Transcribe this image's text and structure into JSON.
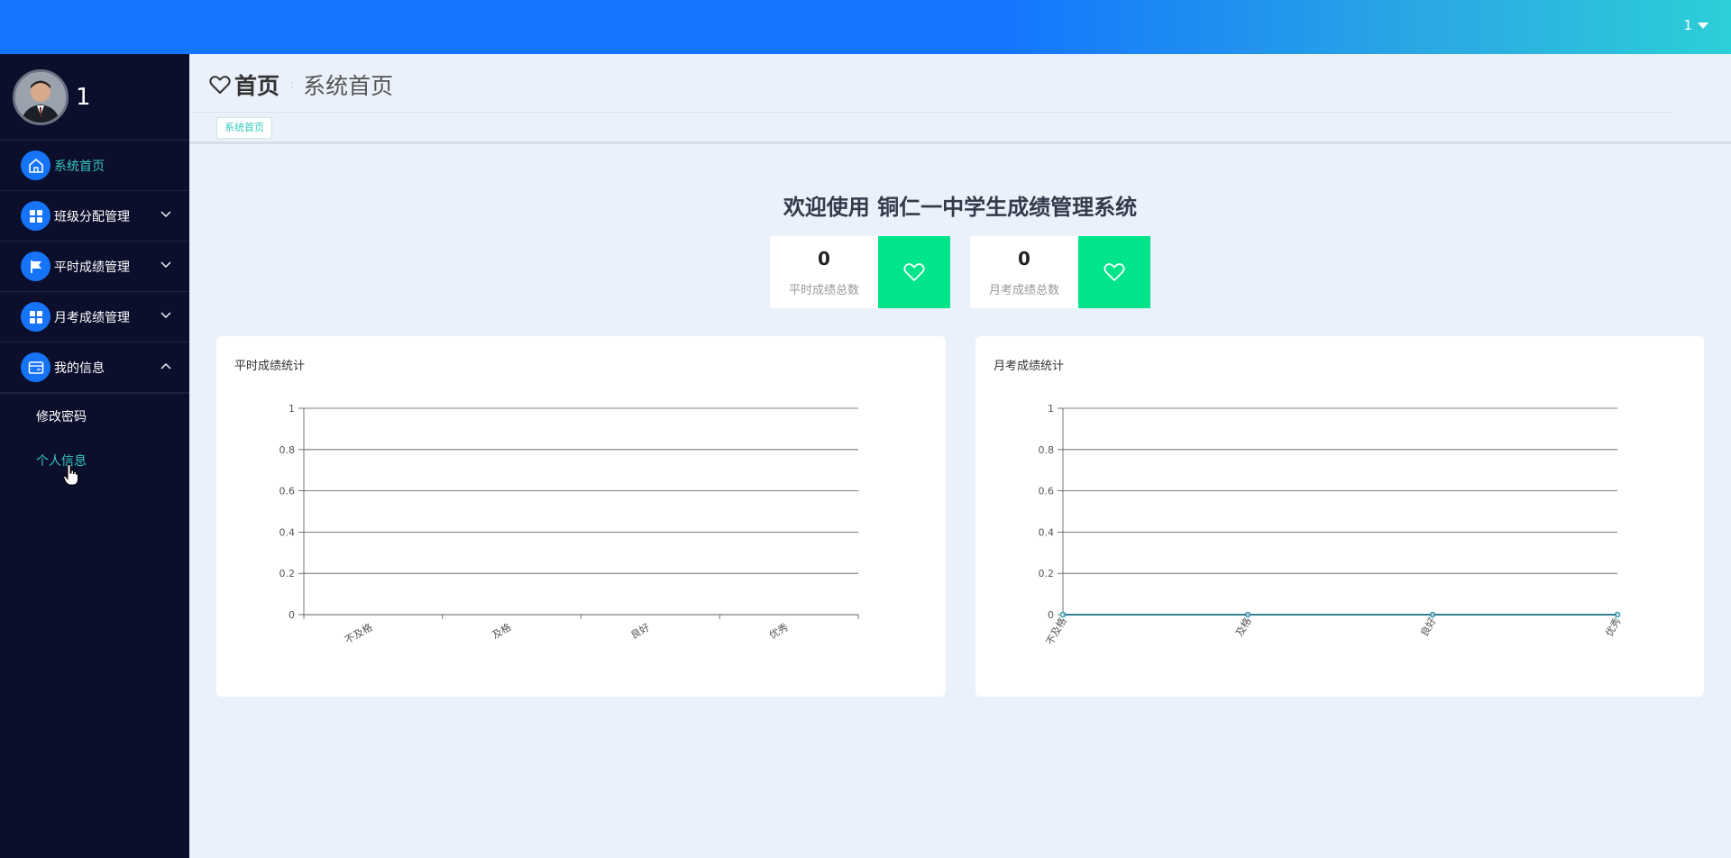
{
  "topbar": {
    "user": "1"
  },
  "sidebar": {
    "profile_name": "1",
    "items": [
      {
        "label": "系统首页",
        "icon": "home-icon",
        "active": true
      },
      {
        "label": "班级分配管理",
        "icon": "grid-icon",
        "chevron": "down"
      },
      {
        "label": "平时成绩管理",
        "icon": "flag-icon",
        "chevron": "down"
      },
      {
        "label": "月考成绩管理",
        "icon": "grid-icon",
        "chevron": "down"
      },
      {
        "label": "我的信息",
        "icon": "card-icon",
        "chevron": "up"
      }
    ],
    "submenu": [
      {
        "label": "修改密码"
      },
      {
        "label": "个人信息",
        "active": true
      }
    ]
  },
  "header": {
    "title": "首页",
    "separator": ":",
    "subtitle": "系统首页"
  },
  "tabs": [
    {
      "label": "系统首页"
    }
  ],
  "welcome": "欢迎使用 铜仁一中学生成绩管理系统",
  "stats": [
    {
      "value": "0",
      "label": "平时成绩总数",
      "icon": "heart-icon"
    },
    {
      "value": "0",
      "label": "月考成绩总数",
      "icon": "heart-icon"
    }
  ],
  "colors": {
    "accent": "#1476fe",
    "teal": "#34c7c0",
    "green": "#00e58a",
    "sidebar": "#0c0f2c"
  },
  "chart_data": [
    {
      "type": "bar",
      "title": "平时成绩统计",
      "categories": [
        "不及格",
        "及格",
        "良好",
        "优秀"
      ],
      "values": [
        0,
        0,
        0,
        0
      ],
      "ylim": [
        0,
        1
      ],
      "yticks": [
        "0",
        "0.2",
        "0.4",
        "0.6",
        "0.8",
        "1"
      ],
      "grid": true
    },
    {
      "type": "line",
      "title": "月考成绩统计",
      "categories": [
        "不及格",
        "及格",
        "良好",
        "优秀"
      ],
      "values": [
        0,
        0,
        0,
        0
      ],
      "ylim": [
        0,
        1
      ],
      "yticks": [
        "0",
        "0.2",
        "0.4",
        "0.6",
        "0.8",
        "1"
      ],
      "grid": true,
      "color": "#1f9ab3"
    }
  ]
}
